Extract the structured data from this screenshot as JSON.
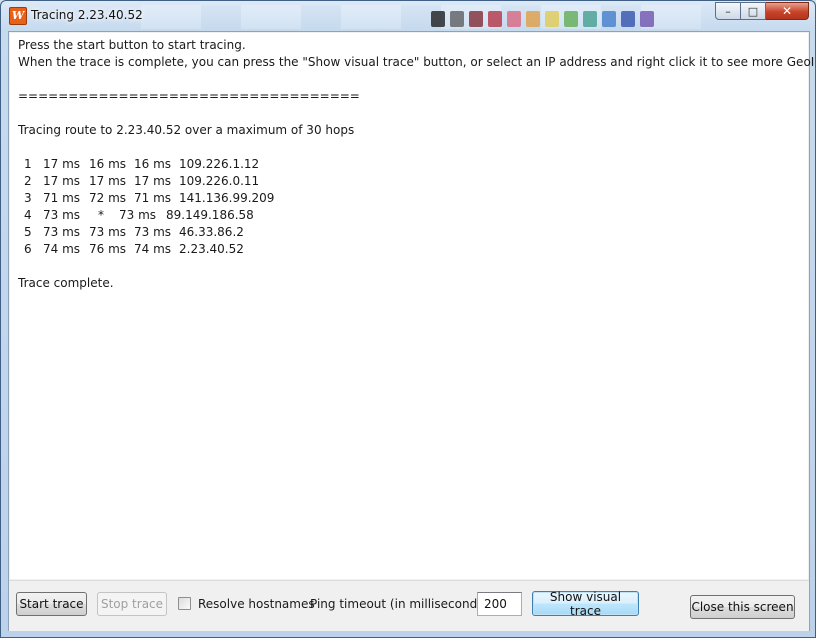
{
  "window": {
    "title": "Tracing 2.23.40.52",
    "app_icon_letter": "W",
    "minimize_glyph": "–",
    "maximize_glyph": "□",
    "close_glyph": "✕",
    "colors": {
      "accent_icon": "#e8611a",
      "close_button": "#c7442a",
      "focused_button_border": "#3c7fb1"
    }
  },
  "output": {
    "intro_line_1": "Press the start button to start tracing.",
    "intro_line_2": "When the trace is complete, you can press the \"Show visual trace\" button, or select an IP address and right click it to see more GeoIP info about it",
    "separator": "==================================",
    "route_header": "Tracing route to 2.23.40.52 over a maximum of 30 hops",
    "hops": [
      {
        "n": "1",
        "t1": "17 ms",
        "t2": "16 ms",
        "t3": "16 ms",
        "ip": "109.226.1.12"
      },
      {
        "n": "2",
        "t1": "17 ms",
        "t2": "17 ms",
        "t3": "17 ms",
        "ip": "109.226.0.11"
      },
      {
        "n": "3",
        "t1": "71 ms",
        "t2": "72 ms",
        "t3": "71 ms",
        "ip": "141.136.99.209"
      },
      {
        "n": "4",
        "t1": "73 ms",
        "t2": "*",
        "t3": "73 ms",
        "ip": "89.149.186.58"
      },
      {
        "n": "5",
        "t1": "73 ms",
        "t2": "73 ms",
        "t3": "73 ms",
        "ip": "46.33.86.2"
      },
      {
        "n": "6",
        "t1": "74 ms",
        "t2": "76 ms",
        "t3": "74 ms",
        "ip": "2.23.40.52"
      }
    ],
    "footer": "Trace complete."
  },
  "toolbar": {
    "start_label": "Start trace",
    "stop_label": "Stop trace",
    "resolve_label": "Resolve hostnames",
    "resolve_checked": false,
    "timeout_label": "Ping timeout (in milliseconds)",
    "timeout_value": "200",
    "visual_label": "Show visual trace",
    "close_label": "Close this screen"
  }
}
